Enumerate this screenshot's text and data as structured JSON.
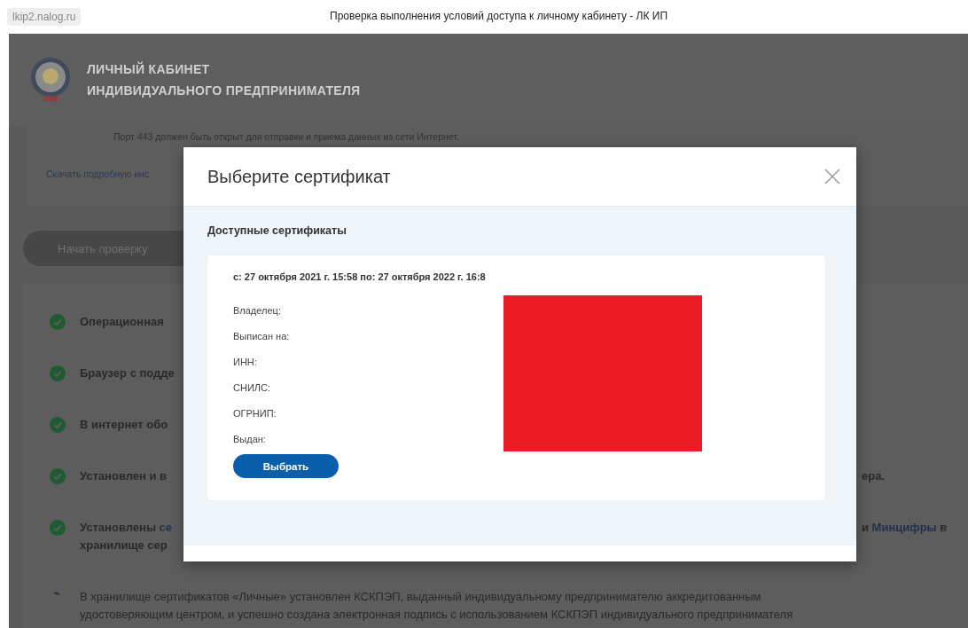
{
  "browser": {
    "url": "lkip2.nalog.ru",
    "title": "Проверка выполнения условий доступа к личному кабинету - ЛК ИП"
  },
  "header": {
    "title_lines": [
      "ЛИЧНЫЙ КАБИНЕТ",
      "ИНДИВИДУАЛЬНОГО ПРЕДПРИНИМАТЕЛЯ"
    ]
  },
  "requirement": "Порт 443 должен быть открыт для отправки и приема данных из сети Интернет.",
  "download_link": "Скачать подробную инс",
  "start_button": "Начать проверку",
  "checks": [
    {
      "completed": true,
      "left": [
        [
          {
            "text": "Операционная",
            "link": false
          }
        ]
      ]
    },
    {
      "completed": true,
      "left": [
        [
          {
            "text": "Браузер с подде",
            "link": false
          }
        ]
      ]
    },
    {
      "completed": true,
      "left": [
        [
          {
            "text": "В интернет обо",
            "link": false
          }
        ]
      ]
    },
    {
      "completed": true,
      "left": [
        [
          {
            "text": "Установлен и в",
            "link": false
          }
        ]
      ],
      "right": [
        [
          {
            "text": "ера.",
            "link": false
          }
        ]
      ]
    },
    {
      "completed": true,
      "left": [
        [
          {
            "text": "Установлены ",
            "link": false
          },
          {
            "text": "се",
            "link": true
          }
        ],
        [
          {
            "text": "хранилище сер",
            "link": false
          }
        ]
      ],
      "right": [
        [
          {
            "text": "и ",
            "link": false
          },
          {
            "text": "Минцифры",
            "link": true
          },
          {
            "text": " в",
            "link": false
          }
        ]
      ]
    },
    {
      "completed": false,
      "left": [
        [
          {
            "text": "В хранилище сертификатов «Личные» установлен КСКПЭП, выданный индивидуальному предпринимателю аккредитованным",
            "link": false
          }
        ],
        [
          {
            "text": "удостоверяющим центром, и успешно создана электронная подпись с использованием КСКПЭП индивидуального предпринимателя",
            "link": false
          }
        ]
      ]
    }
  ],
  "modal": {
    "title": "Выберите сертификат",
    "section_title": "Доступные сертификаты",
    "certificate": {
      "validity": "с: 27 октября 2021 г. 15:58 по: 27 октября 2022 г. 16:8",
      "fields": [
        "Владелец:",
        "Выписан на:",
        "ИНН:",
        "СНИЛС:",
        "ОГРНИП:",
        "Выдан:"
      ],
      "button": "Выбрать"
    }
  }
}
